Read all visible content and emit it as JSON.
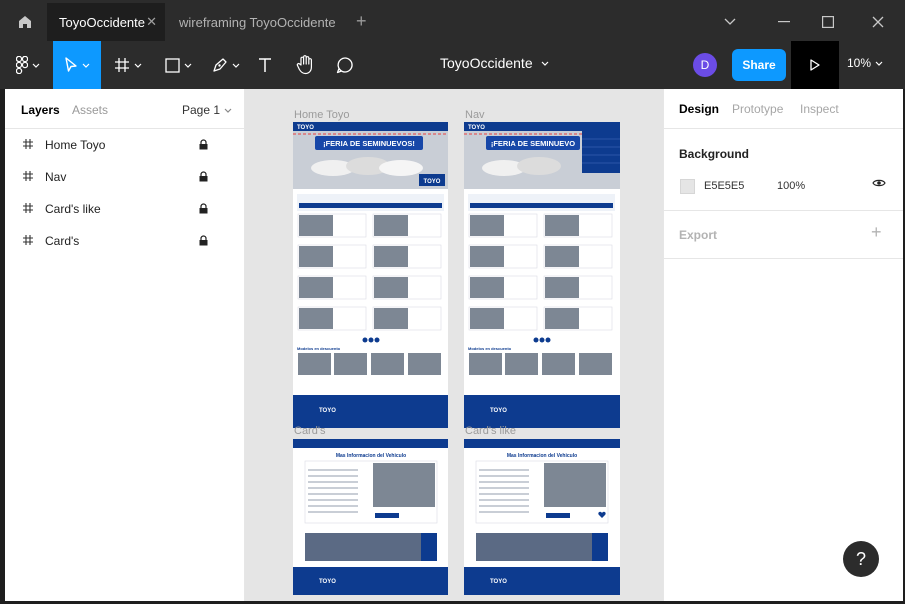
{
  "tabs": [
    {
      "label": "ToyoOccidente",
      "active": true
    },
    {
      "label": "wireframing ToyoOccidente",
      "active": false
    }
  ],
  "tab_close_glyph": "✕",
  "tab_add_glyph": "+",
  "file_title": "ToyoOccidente",
  "avatar_initial": "D",
  "share_label": "Share",
  "zoom_label": "10%",
  "layers_panel": {
    "tab_layers": "Layers",
    "tab_assets": "Assets",
    "page_label": "Page 1",
    "layers": [
      {
        "name": "Home Toyo",
        "locked": true
      },
      {
        "name": "Nav",
        "locked": true
      },
      {
        "name": "Card's like",
        "locked": true
      },
      {
        "name": "Card's",
        "locked": true
      }
    ]
  },
  "canvas": {
    "background": "#E5E5E5",
    "frames": {
      "home": {
        "label": "Home Toyo",
        "banner": "¡FERIA DE SEMINUEVOS!",
        "brand": "TOYO",
        "section_title": "Modelos en descuento"
      },
      "nav": {
        "label": "Nav",
        "banner": "¡FERIA DE SEMINUEVO",
        "brand": "TOYO",
        "section_title": "Modelos en descuento"
      },
      "cards": {
        "label": "Card's",
        "detail_title": "Mas Informacion del Vehiculo",
        "brand": "TOYO"
      },
      "cards_like": {
        "label": "Card's like",
        "detail_title": "Mas Informacion del Vehiculo",
        "brand": "TOYO"
      }
    }
  },
  "design_panel": {
    "tab_design": "Design",
    "tab_prototype": "Prototype",
    "tab_inspect": "Inspect",
    "background_title": "Background",
    "background_hex": "E5E5E5",
    "background_opacity": "100%",
    "export_title": "Export",
    "export_add": "+"
  },
  "help_label": "?",
  "colors": {
    "accent": "#0D99FF",
    "brand_blue": "#0D3B8F",
    "chrome": "#2C2C2C"
  },
  "icons": [
    "home-icon",
    "close-icon",
    "plus-icon",
    "chevron-down-icon",
    "minimize-icon",
    "maximize-icon",
    "figma-logo-icon",
    "move-tool-icon",
    "frame-tool-icon",
    "rectangle-tool-icon",
    "pen-tool-icon",
    "text-tool-icon",
    "hand-tool-icon",
    "comment-icon",
    "play-icon",
    "hash-icon",
    "lock-icon",
    "eye-icon"
  ]
}
